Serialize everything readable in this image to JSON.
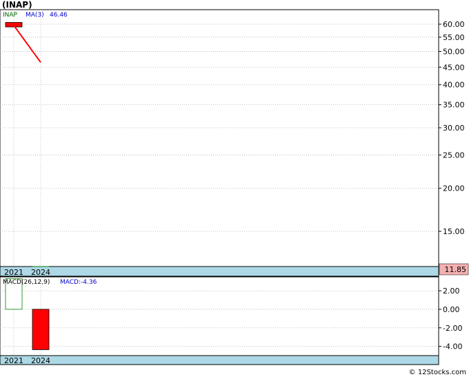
{
  "header": {
    "title": "(INAP)"
  },
  "footer": {
    "credit": "© 12Stocks.com"
  },
  "chart_data": [
    {
      "type": "candlestick",
      "panel": "price",
      "symbol": "INAP",
      "scale": "log",
      "ylim": [
        11.85,
        65
      ],
      "yticks": [
        60,
        55,
        50,
        45,
        40,
        35,
        30,
        25,
        20,
        15
      ],
      "ytick_labels": [
        "60.00",
        "55.00",
        "50.00",
        "45.00",
        "40.00",
        "35.00",
        "30.00",
        "25.00",
        "20.00",
        "15.00"
      ],
      "x_labels": [
        "2021",
        "2024"
      ],
      "candles": [
        {
          "x": "2021",
          "open": 60.7,
          "high": 60.7,
          "low": 58.9,
          "close": 58.9,
          "color": "#ff0000"
        },
        {
          "x": "2024",
          "open": 11.85,
          "high": 11.85,
          "low": 11.85,
          "close": 11.85,
          "color": "#008000"
        }
      ],
      "ma": {
        "name": "MA(3)",
        "value_label": "46.46",
        "points": [
          {
            "x": "2021",
            "y": 59.5
          },
          {
            "x": "2024",
            "y": 46.46
          }
        ],
        "color": "#ff0000"
      },
      "last_price": {
        "label": "11.85",
        "value": 11.85,
        "bg": "#f4b0b0"
      },
      "legend": {
        "symbol_label": "INAP",
        "ma_label": "MA(3)",
        "ma_value": "46.46",
        "placement": "top-left"
      }
    },
    {
      "type": "bar",
      "panel": "macd",
      "name": "MACD(26,12,9)",
      "value_label": "MACD:-4.36",
      "ylim": [
        -5,
        3.5
      ],
      "yticks": [
        2,
        0,
        -2,
        -4
      ],
      "ytick_labels": [
        "2.00",
        "0.00",
        "-2.00",
        "-4.00"
      ],
      "categories": [
        "2021",
        "2024"
      ],
      "values": [
        3.3,
        -4.36
      ],
      "colors": [
        "#ffffff",
        "#ff0000"
      ],
      "x_labels": [
        "2021",
        "2024"
      ]
    }
  ],
  "colors": {
    "grid": "#b0b0b0",
    "date_band": "#add8e6",
    "frame": "#000000",
    "up": "#008000",
    "down": "#ff0000",
    "ma_label": "#0000cc",
    "symbol_label": "#006600"
  }
}
